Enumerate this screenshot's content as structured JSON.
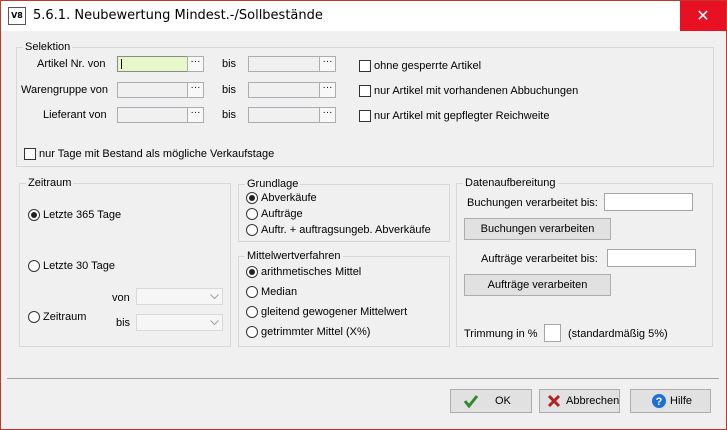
{
  "window": {
    "icon_text": "V8",
    "title": "5.6.1. Neubewertung Mindest.-/Sollbestände",
    "close_glyph": "✕"
  },
  "selektion": {
    "title": "Selektion",
    "rows": [
      {
        "label": "Artikel Nr. von",
        "to_label": "bis"
      },
      {
        "label": "Warengruppe von",
        "to_label": "bis"
      },
      {
        "label": "Lieferant von",
        "to_label": "bis"
      }
    ],
    "dots": "···",
    "checkboxes": {
      "ohne_gesperrte": "ohne gesperrte Artikel",
      "mit_abbuchungen": "nur Artikel mit vorhandenen Abbuchungen",
      "mit_reichweite": "nur Artikel mit gepflegter Reichweite",
      "tage_bestand": "nur Tage mit Bestand als mögliche Verkaufstage"
    }
  },
  "zeitraum": {
    "title": "Zeitraum",
    "options": [
      "Letzte 365 Tage",
      "Letzte 30 Tage",
      "Zeitraum"
    ],
    "selected": 0,
    "von_label": "von",
    "bis_label": "bis"
  },
  "grundlage": {
    "title": "Grundlage",
    "options": [
      "Abverkäufe",
      "Aufträge",
      "Auftr. + auftragsungeb. Abverkäufe"
    ],
    "selected": 0
  },
  "mittelwert": {
    "title": "Mittelwertverfahren",
    "options": [
      "arithmetisches Mittel",
      "Median",
      "gleitend gewogener Mittelwert",
      "getrimmter Mittel (X%)"
    ],
    "selected": 0
  },
  "datenaufbereitung": {
    "title": "Datenaufbereitung",
    "buchungen_label": "Buchungen verarbeitet bis:",
    "buchungen_button": "Buchungen verarbeiten",
    "auftraege_label": "Aufträge verarbeitet bis:",
    "auftraege_button": "Aufträge verarbeiten",
    "trimmung_label": "Trimmung in %",
    "trimmung_hint": "(standardmäßig 5%)"
  },
  "footer": {
    "ok_label": "OK",
    "abbrechen_label": "Abbrechen",
    "hilfe_label": "Hilfe"
  },
  "colors": {
    "active_field": "#e6f7c8",
    "close_button": "#e81123",
    "ok_icon": "#2e8b2e",
    "cancel_icon": "#b22222",
    "help_icon": "#1e6fd9"
  }
}
